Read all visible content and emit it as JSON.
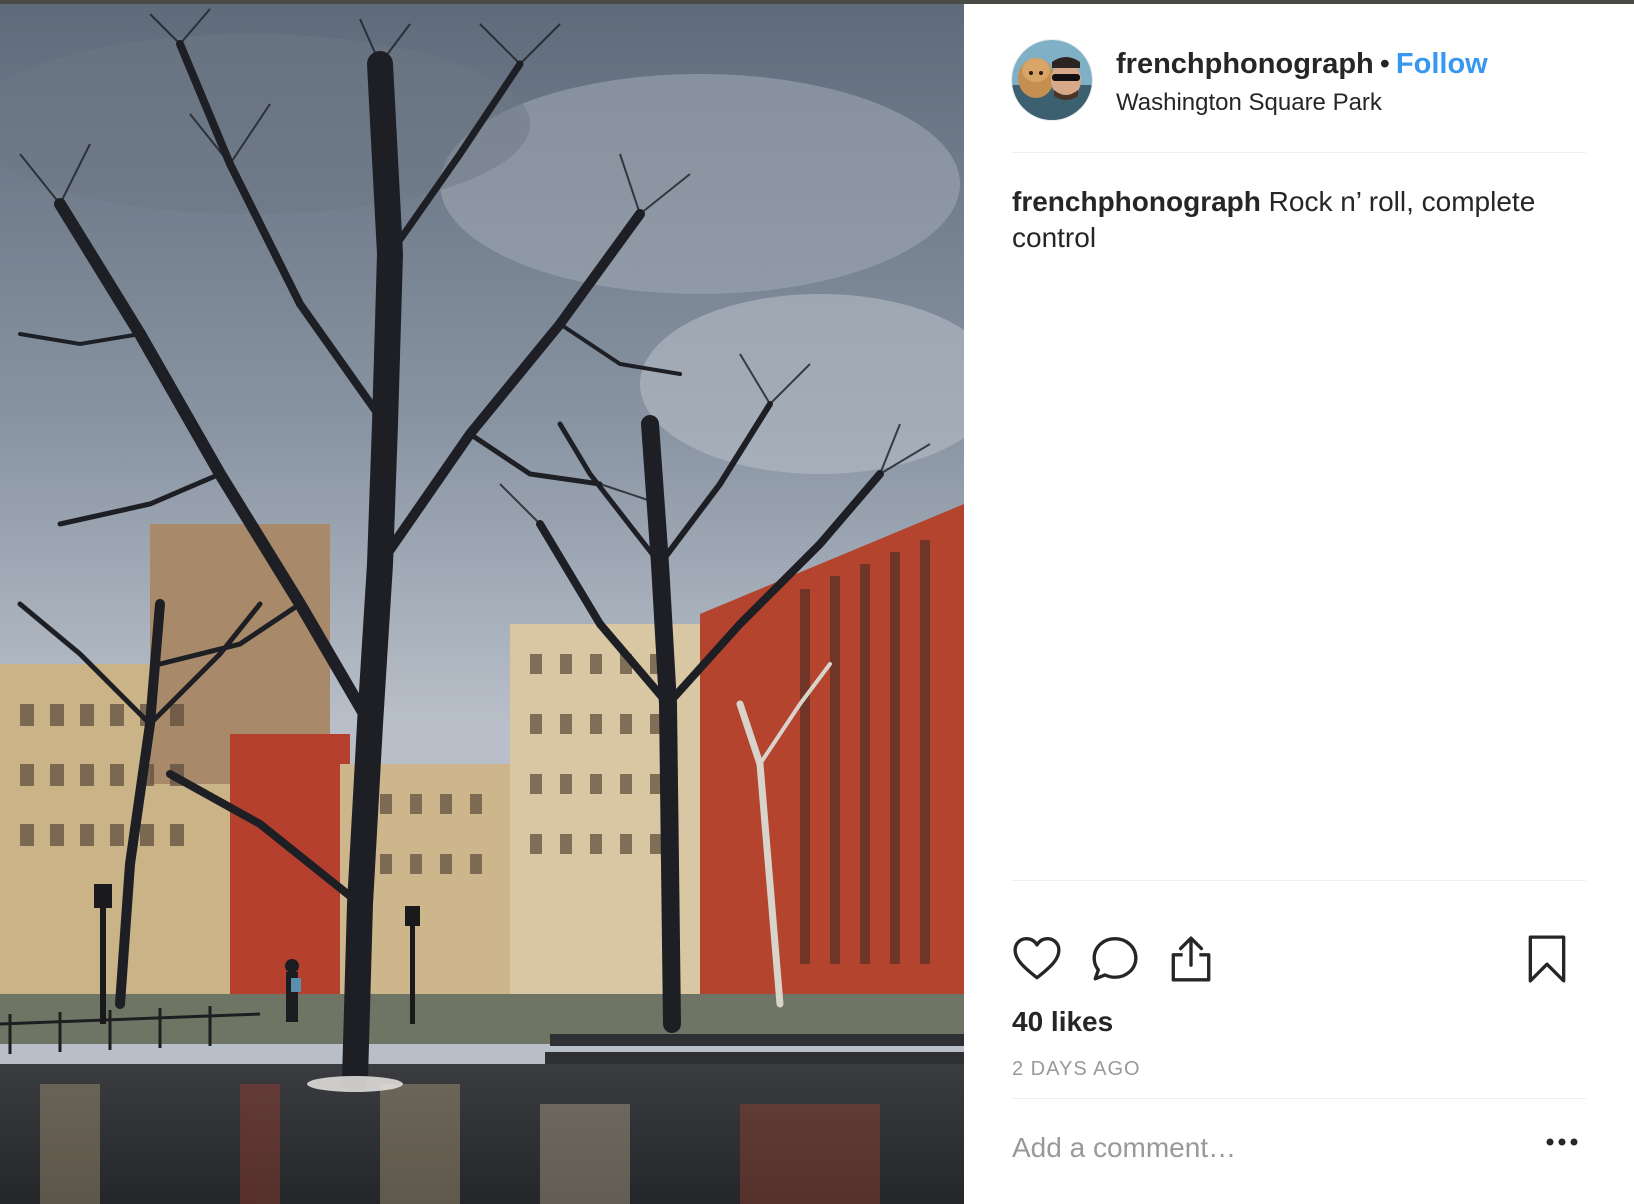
{
  "post": {
    "username": "frenchphonograph",
    "separator": "•",
    "follow_label": "Follow",
    "location": "Washington Square Park",
    "caption_user": "frenchphonograph",
    "caption_text": " Rock n’ roll, complete control",
    "likes": "40 likes",
    "time_ago": "2 DAYS AGO"
  },
  "comment": {
    "placeholder": "Add a comment…"
  },
  "icons": {
    "like": "heart-icon",
    "comment": "comment-icon",
    "share": "share-icon",
    "save": "bookmark-icon",
    "more": "more-options-icon"
  },
  "colors": {
    "follow": "#3897f0",
    "text": "#262626",
    "muted": "#999999",
    "divider": "#efefef"
  }
}
